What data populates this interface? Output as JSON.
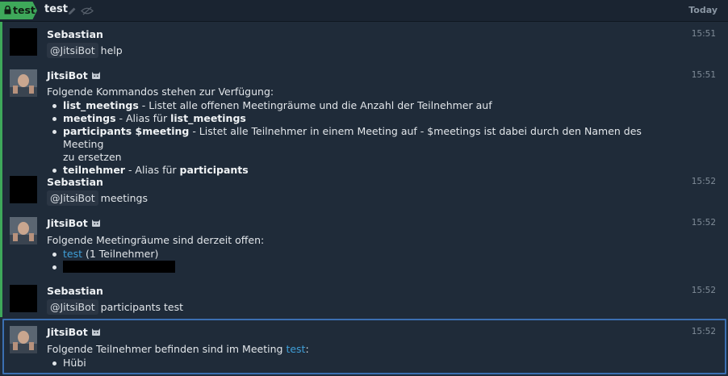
{
  "header": {
    "room_tag": "test",
    "room_name": "test",
    "date_label": "Today"
  },
  "messages": [
    {
      "sender": "Sebastian",
      "time": "15:51",
      "mention": "@JitsiBot",
      "text": "help"
    },
    {
      "sender": "JitsiBot",
      "time": "15:51",
      "intro": "Folgende Kommandos stehen zur Verfügung:",
      "items": [
        {
          "cmd": "list_meetings",
          "desc": " - Listet alle offenen Meetingräume und die Anzahl der Teilnehmer auf"
        },
        {
          "cmd": "meetings",
          "desc": " - Alias für ",
          "ref": "list_meetings"
        },
        {
          "cmd": "participants $meeting",
          "desc": " - Listet alle Teilnehmer in einem Meeting auf - $meetings ist dabei durch den Namen des Meeting",
          "desc2": "zu ersetzen"
        },
        {
          "cmd": "teilnehmer",
          "desc": " - Alias für ",
          "ref": "participants"
        }
      ]
    },
    {
      "sender": "Sebastian",
      "time": "15:52",
      "mention": "@JitsiBot",
      "text": "meetings"
    },
    {
      "sender": "JitsiBot",
      "time": "15:52",
      "intro": "Folgende Meetingräume sind derzeit offen:",
      "items": [
        {
          "link": "test",
          "suffix": " (1 Teilnehmer)"
        }
      ]
    },
    {
      "sender": "Sebastian",
      "time": "15:52",
      "mention": "@JitsiBot",
      "text": "participants test"
    },
    {
      "sender": "JitsiBot",
      "time": "15:52",
      "intro": "Folgende Teilnehmer befinden sind im Meeting ",
      "link": "test",
      "after": ":",
      "items": [
        "Hübi"
      ]
    }
  ]
}
